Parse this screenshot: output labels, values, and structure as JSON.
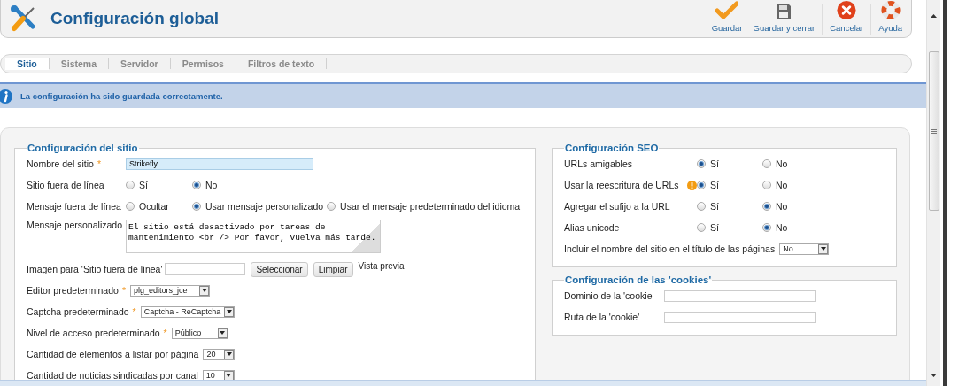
{
  "header": {
    "title": "Configuración global",
    "toolbar": [
      {
        "kind": "save",
        "label": "Guardar"
      },
      {
        "kind": "save-close",
        "label": "Guardar y cerrar"
      },
      {
        "kind": "cancel",
        "label": "Cancelar"
      },
      {
        "kind": "help",
        "label": "Ayuda"
      }
    ]
  },
  "tabs": [
    {
      "label": "Sitio",
      "selected": true
    },
    {
      "label": "Sistema",
      "selected": false
    },
    {
      "label": "Servidor",
      "selected": false
    },
    {
      "label": "Permisos",
      "selected": false
    },
    {
      "label": "Filtros de texto",
      "selected": false
    }
  ],
  "message": "La configuración ha sido guardada correctamente.",
  "site_config": {
    "legend": "Configuración del sitio",
    "fields": [
      {
        "kind": "text",
        "label": "Nombre del sitio",
        "required_mark": "*",
        "value": "Strikefly"
      },
      {
        "kind": "radio",
        "label": "Sitio fuera de línea",
        "options": [
          {
            "label": "Sí",
            "selected": false
          },
          {
            "label": "No",
            "selected": true
          }
        ]
      },
      {
        "kind": "radio",
        "label": "Mensaje fuera de línea",
        "options": [
          {
            "label": "Ocultar",
            "selected": false
          },
          {
            "label": "Usar mensaje personalizado",
            "selected": true
          },
          {
            "label": "Usar el mensaje predeterminado del idioma",
            "selected": false
          }
        ]
      },
      {
        "kind": "textarea",
        "label": "Mensaje personalizado",
        "value": "El sitio está desactivado por tareas de mantenimiento <br /> Por favor, vuelva más tarde."
      },
      {
        "kind": "image",
        "label": "Imagen para 'Sitio fuera de línea'",
        "buttons": [
          "Seleccionar",
          "Limpiar"
        ],
        "preview": "Vista previa"
      },
      {
        "kind": "select",
        "label": "Editor predeterminado",
        "required_mark": "*",
        "value": "plg_editors_jce"
      },
      {
        "kind": "select",
        "label": "Captcha predeterminado",
        "required_mark": "*",
        "value": "Captcha - ReCaptcha"
      },
      {
        "kind": "select",
        "label": "Nivel de acceso predeterminado",
        "required_mark": "*",
        "value": "Público"
      },
      {
        "kind": "select",
        "label": "Cantidad de elementos a listar por página",
        "value": "20"
      },
      {
        "kind": "select",
        "label": "Cantidad de noticias sindicadas por canal",
        "value": "10"
      }
    ]
  },
  "seo": {
    "legend": "Configuración SEO",
    "fields": [
      {
        "kind": "radio",
        "label": "URLs amigables",
        "warning": false,
        "options": [
          {
            "label": "Sí",
            "selected": true
          },
          {
            "label": "No",
            "selected": false
          }
        ]
      },
      {
        "kind": "radio",
        "label": "Usar la reescritura de URLs",
        "warning": true,
        "options": [
          {
            "label": "Sí",
            "selected": true
          },
          {
            "label": "No",
            "selected": false
          }
        ]
      },
      {
        "kind": "radio",
        "label": "Agregar el sufijo a la URL",
        "warning": false,
        "options": [
          {
            "label": "Sí",
            "selected": false
          },
          {
            "label": "No",
            "selected": true
          }
        ]
      },
      {
        "kind": "radio",
        "label": "Alias unicode",
        "warning": false,
        "options": [
          {
            "label": "Sí",
            "selected": false
          },
          {
            "label": "No",
            "selected": true
          }
        ]
      },
      {
        "kind": "select",
        "label": "Incluir el nombre del sitio en el título de las páginas",
        "value": "No"
      }
    ]
  },
  "cookies": {
    "legend": "Configuración de las 'cookies'",
    "fields": [
      {
        "kind": "text",
        "label": "Dominio de la 'cookie'"
      },
      {
        "kind": "text",
        "label": "Ruta de la 'cookie'"
      }
    ]
  }
}
